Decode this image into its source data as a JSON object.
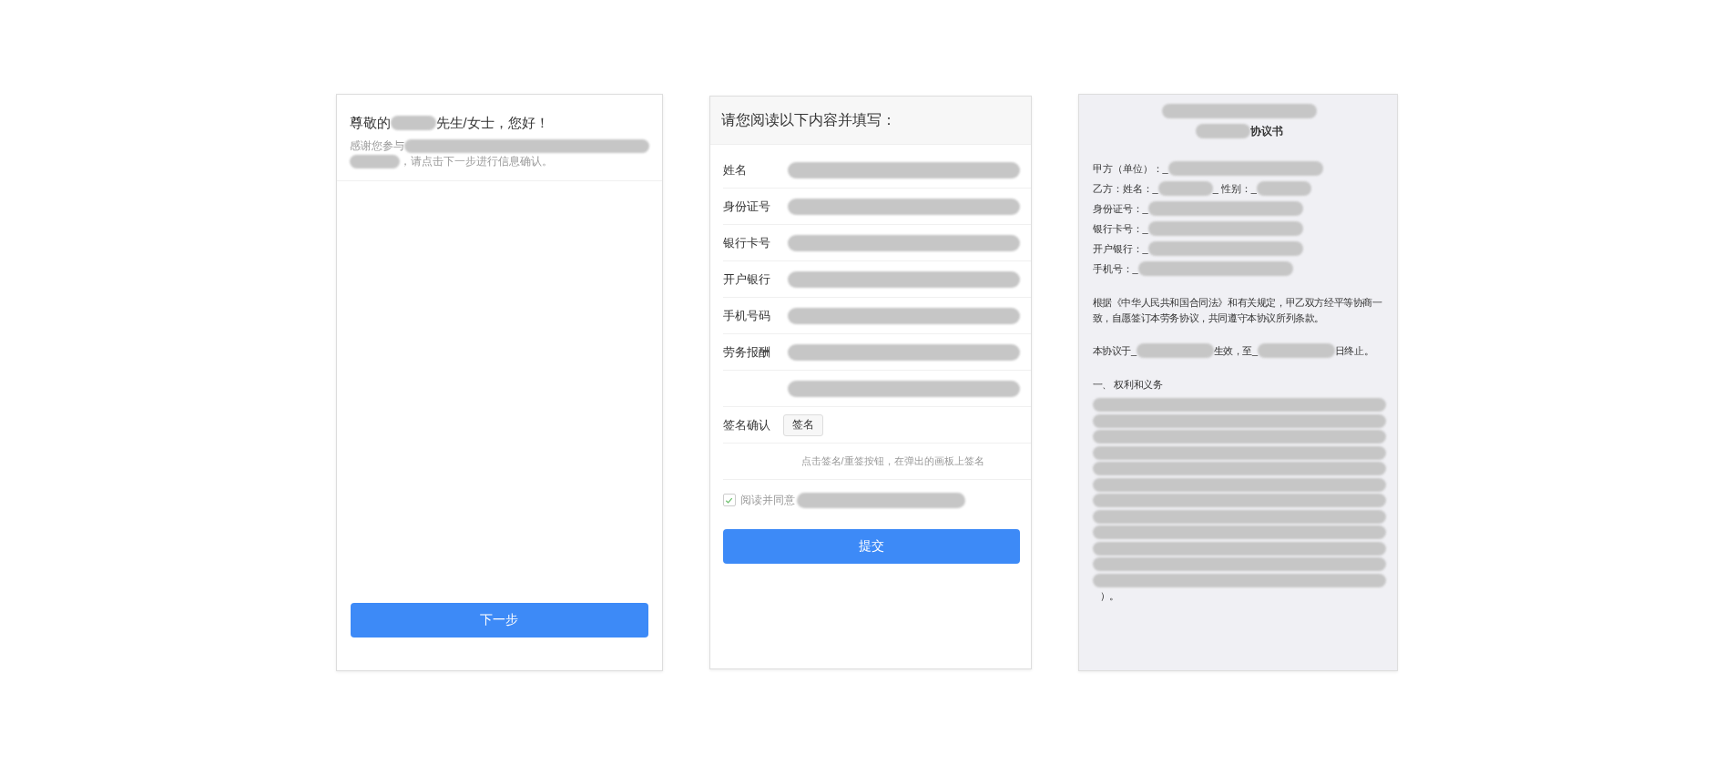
{
  "welcome_panel": {
    "greeting": [
      {
        "kind": "text",
        "text": "尊敬的"
      },
      {
        "kind": "blur"
      },
      {
        "kind": "text",
        "text": "先生/女士，您好！"
      }
    ],
    "intro": [
      [
        {
          "kind": "text",
          "text": "感谢您参与"
        },
        {
          "kind": "blur"
        }
      ],
      [
        {
          "kind": "blur"
        },
        {
          "kind": "text",
          "text": "，请点击下一步进行信息确认。"
        }
      ]
    ],
    "next_button": "下一步"
  },
  "form_panel": {
    "title": "请您阅读以下内容并填写：",
    "fields": [
      {
        "kind": "labeled",
        "label": "姓名"
      },
      {
        "kind": "labeled",
        "label": "身份证号"
      },
      {
        "kind": "labeled",
        "label": "银行卡号"
      },
      {
        "kind": "labeled",
        "label": "开户银行"
      },
      {
        "kind": "labeled",
        "label": "手机号码"
      },
      {
        "kind": "labeled",
        "label": "劳务报酬"
      },
      {
        "kind": "unlabeled"
      }
    ],
    "signature": {
      "label": "签名确认",
      "button": "签名",
      "hint": "点击签名/重签按钮，在弹出的画板上签名"
    },
    "agree": {
      "checked": true,
      "label": "阅读并同意"
    },
    "submit_button": "提交"
  },
  "agreement_panel": {
    "title_lines": [
      [
        {
          "kind": "blur"
        }
      ],
      [
        {
          "kind": "blur"
        },
        {
          "kind": "text",
          "text": "协议书"
        }
      ]
    ],
    "party_lines": [
      [
        {
          "kind": "text",
          "text": "甲方（单位）：_"
        },
        {
          "kind": "blur"
        }
      ],
      [
        {
          "kind": "text",
          "text": "乙方：姓名：_"
        },
        {
          "kind": "blur"
        },
        {
          "kind": "text",
          "text": "_ 性别：_"
        },
        {
          "kind": "blur"
        }
      ],
      [
        {
          "kind": "text",
          "text": "身份证号：_"
        },
        {
          "kind": "blur"
        }
      ],
      [
        {
          "kind": "text",
          "text": "银行卡号：_"
        },
        {
          "kind": "blur"
        }
      ],
      [
        {
          "kind": "text",
          "text": "开户银行：_"
        },
        {
          "kind": "blur"
        }
      ],
      [
        {
          "kind": "text",
          "text": "手机号：_"
        },
        {
          "kind": "blur"
        }
      ]
    ],
    "preamble": "根据《中华人民共和国合同法》和有关规定，甲乙双方经平等协商一致，自愿签订本劳务协议，共同遵守本协议所列条款。",
    "term": [
      {
        "kind": "text",
        "text": "本协议于_"
      },
      {
        "kind": "blur"
      },
      {
        "kind": "text",
        "text": "生效，至_"
      },
      {
        "kind": "blur"
      },
      {
        "kind": "text",
        "text": "日终止。"
      }
    ],
    "section_heading": "一、 权利和义务",
    "body_lines": [
      [
        {
          "kind": "blur"
        }
      ],
      [
        {
          "kind": "blur"
        }
      ],
      [
        {
          "kind": "blur"
        }
      ],
      [
        {
          "kind": "blur"
        }
      ],
      [
        {
          "kind": "blur"
        }
      ],
      [
        {
          "kind": "blur"
        }
      ],
      [
        {
          "kind": "blur"
        }
      ],
      [
        {
          "kind": "blur"
        }
      ],
      [
        {
          "kind": "blur"
        }
      ],
      [
        {
          "kind": "blur"
        }
      ],
      [
        {
          "kind": "blur"
        }
      ],
      [
        {
          "kind": "blur"
        }
      ]
    ],
    "closing": "）。"
  }
}
